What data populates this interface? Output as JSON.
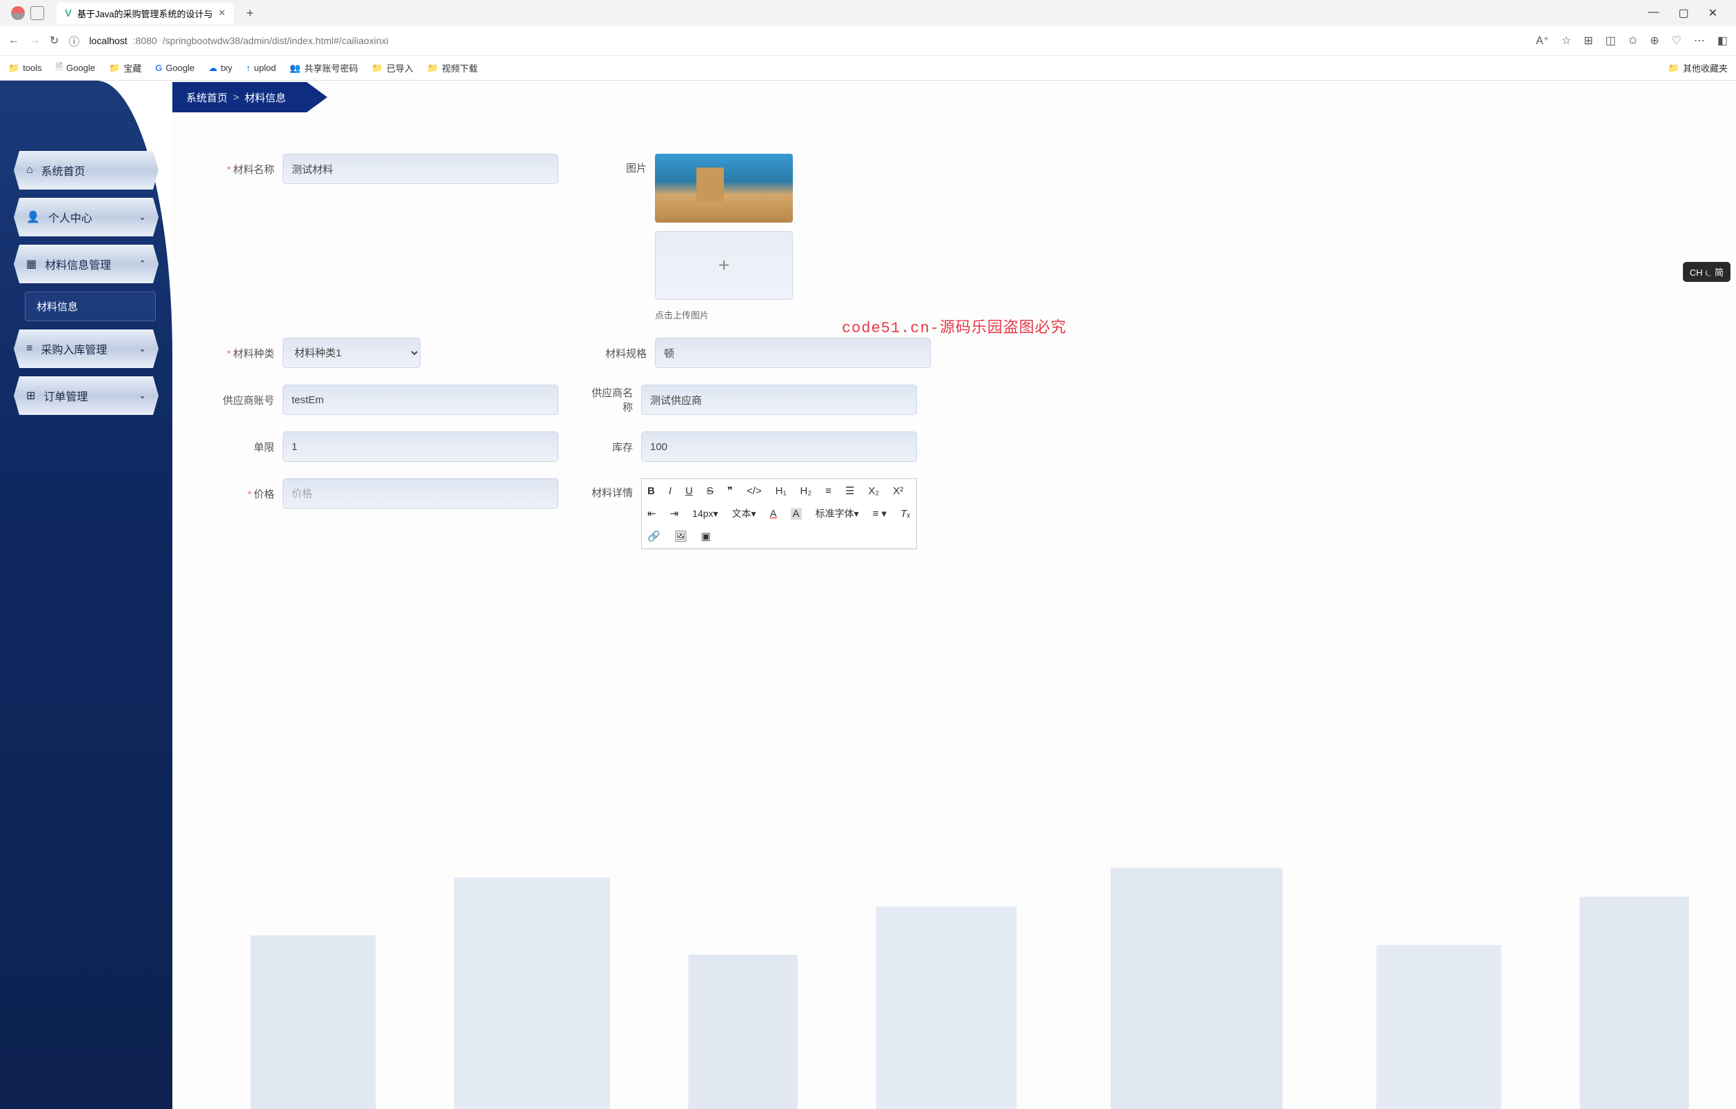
{
  "browser": {
    "tab_title": "基于Java的采购管理系统的设计与",
    "url_host": "localhost",
    "url_port": ":8080",
    "url_path": "/springbootwdw38/admin/dist/index.html#/cailiaoxinxi",
    "bookmarks": [
      {
        "label": "tools",
        "icon": "folder"
      },
      {
        "label": "Google",
        "icon": "file"
      },
      {
        "label": "宝藏",
        "icon": "folder"
      },
      {
        "label": "Google",
        "icon": "g"
      },
      {
        "label": "txy",
        "icon": "cloud"
      },
      {
        "label": "uplod",
        "icon": "upload"
      },
      {
        "label": "共享账号密码",
        "icon": "share"
      },
      {
        "label": "已导入",
        "icon": "folder"
      },
      {
        "label": "视频下载",
        "icon": "folder"
      }
    ],
    "other_bookmarks": "其他收藏夹"
  },
  "sidebar": {
    "items": [
      {
        "label": "系统首页",
        "icon": "⌂",
        "has_sub": false
      },
      {
        "label": "个人中心",
        "icon": "👤",
        "has_sub": true,
        "open": false
      },
      {
        "label": "材料信息管理",
        "icon": "▦",
        "has_sub": true,
        "open": true
      },
      {
        "label": "采购入库管理",
        "icon": "≡",
        "has_sub": true,
        "open": false
      },
      {
        "label": "订单管理",
        "icon": "⊞",
        "has_sub": true,
        "open": false
      }
    ],
    "sub_item": "材料信息"
  },
  "breadcrumb": {
    "home": "系统首页",
    "sep": ">",
    "current": "材料信息"
  },
  "form": {
    "material_name": {
      "label": "材料名称",
      "value": "测试材料",
      "required": true
    },
    "image": {
      "label": "图片",
      "upload_hint": "点击上传图片"
    },
    "material_type": {
      "label": "材料种类",
      "value": "材料种类1",
      "required": true
    },
    "material_spec": {
      "label": "材料规格",
      "value": "顿"
    },
    "supplier_account": {
      "label": "供应商账号",
      "value": "testEm"
    },
    "supplier_name": {
      "label": "供应商名称",
      "value": "测试供应商"
    },
    "limit": {
      "label": "单限",
      "value": "1"
    },
    "stock": {
      "label": "库存",
      "value": "100"
    },
    "price": {
      "label": "价格",
      "placeholder": "价格",
      "required": true
    },
    "detail": {
      "label": "材料详情"
    }
  },
  "editor": {
    "font_size": "14px",
    "font_family": "标准字体",
    "text_label": "文本"
  },
  "watermark": "code51.cn",
  "overlay": "code51.cn-源码乐园盗图必究",
  "ime": "CH ⏾ 简"
}
